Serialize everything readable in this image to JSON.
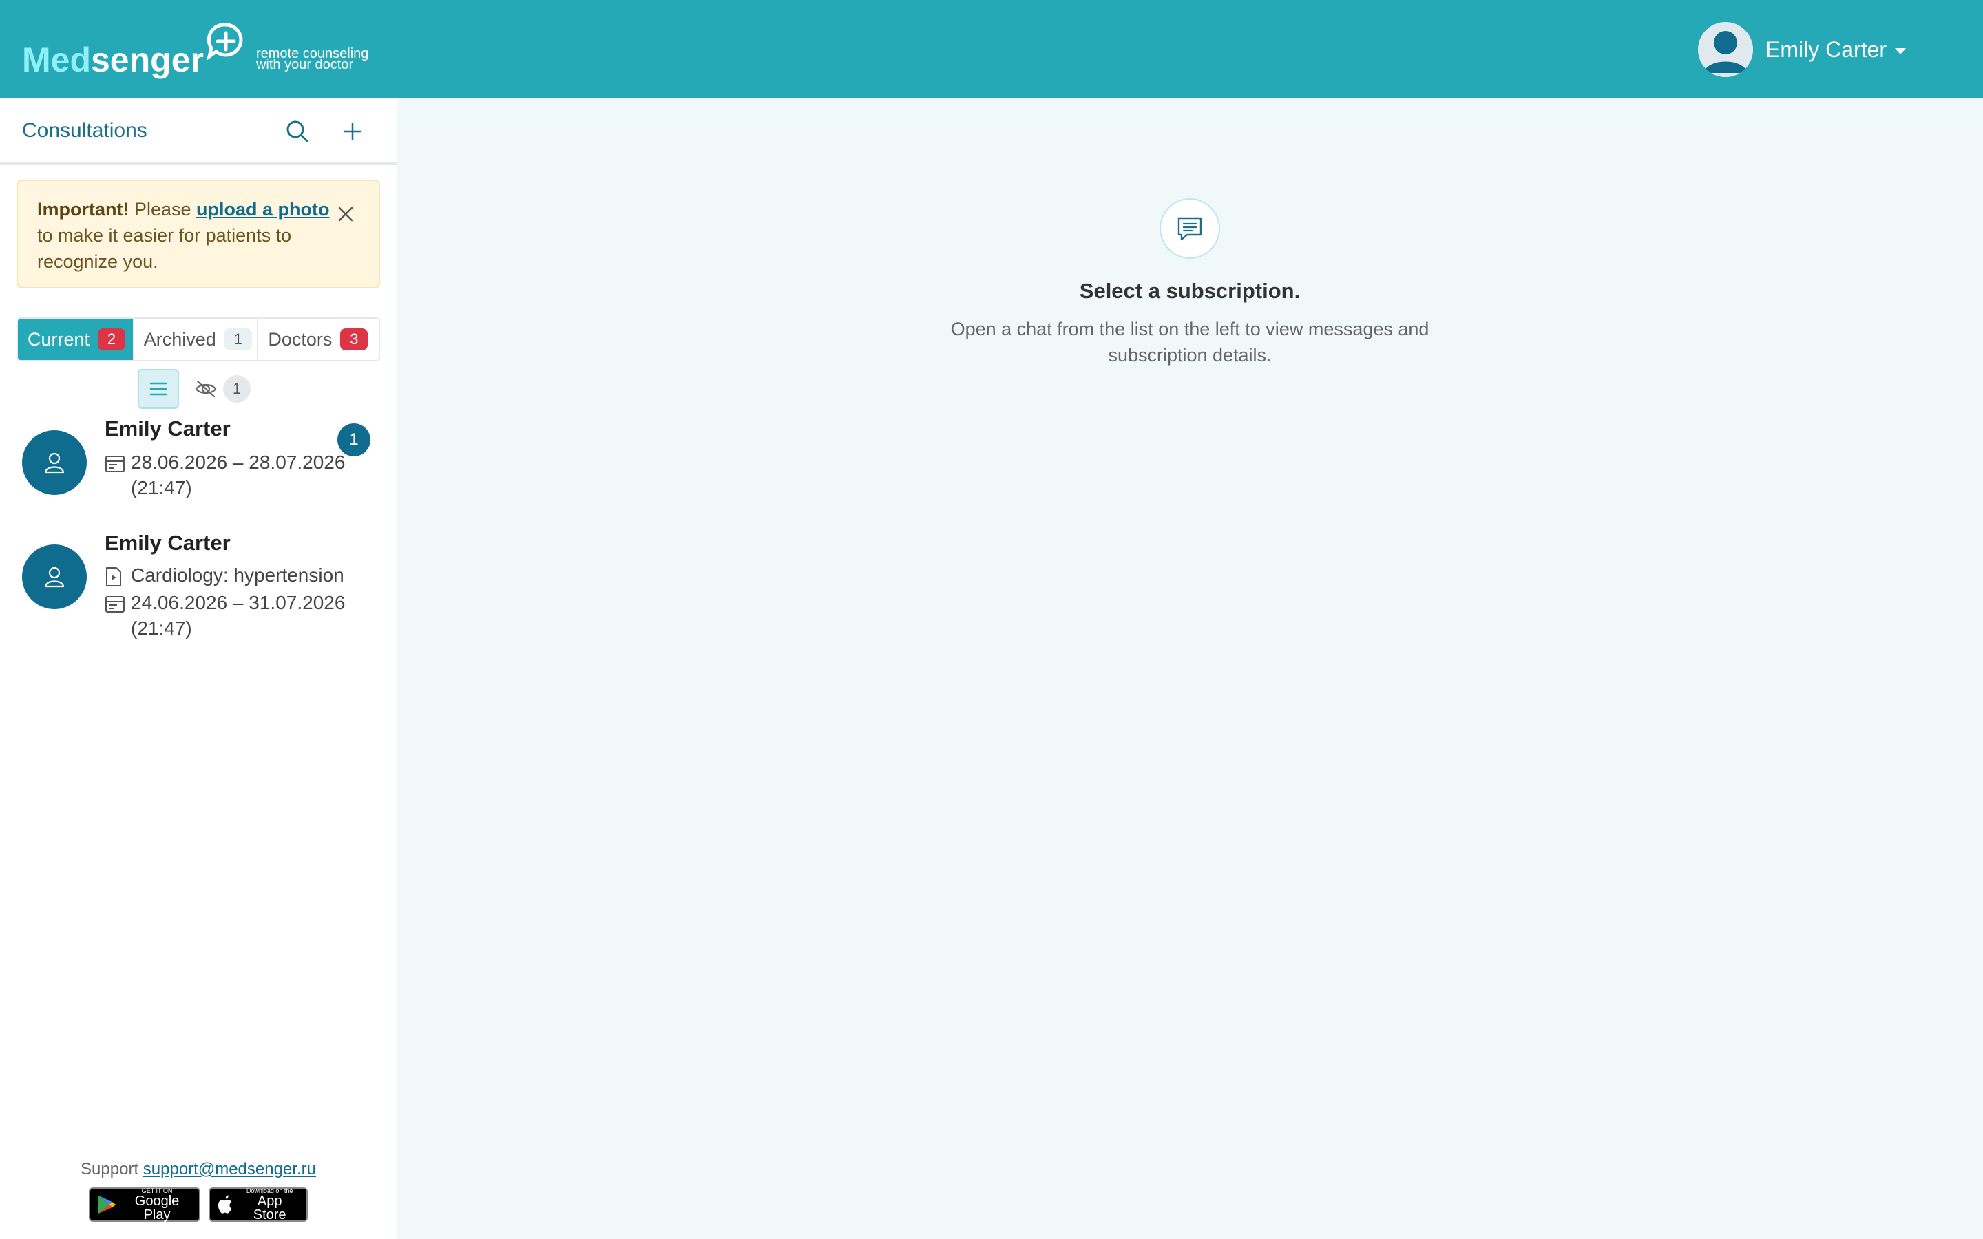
{
  "header": {
    "logo": {
      "med": "Med",
      "senger": "senger",
      "tagline_1": "remote counseling",
      "tagline_2": "with your doctor"
    },
    "user_name": "Emily Carter"
  },
  "sidebar": {
    "title": "Consultations",
    "notice": {
      "bold": "Important!",
      "pre_link": " Please ",
      "link": "upload a photo",
      "post_link": " to make it easier for patients to recognize you."
    },
    "tabs": [
      {
        "label": "Current",
        "count": "2"
      },
      {
        "label": "Archived",
        "count": "1"
      },
      {
        "label": "Doctors",
        "count": "3"
      }
    ],
    "hidden_count": "1",
    "chats": [
      {
        "name": "Emily Carter",
        "date_range": "28.06.2026 – 28.07.2026",
        "time": "(21:47)",
        "unread": "1"
      },
      {
        "name": "Emily Carter",
        "program": "Cardiology: hypertension",
        "date_range": "24.06.2026 – 31.07.2026",
        "time": "(21:47)"
      }
    ],
    "footer": {
      "support_label": "Support",
      "support_email": "support@medsenger.ru",
      "google_small": "GET IT ON",
      "google_big": "Google Play",
      "apple_small": "Download on the",
      "apple_big": "App Store"
    }
  },
  "main": {
    "empty_title": "Select a subscription.",
    "empty_text": "Open a chat from the list on the left to view messages and subscription details."
  },
  "colors": {
    "header": "#25a9b6",
    "accent": "#0f6c8f",
    "badge_red": "#dc3545",
    "notice_bg": "#fff6df"
  },
  "icons": [
    "logo-plus-bubble-icon",
    "user-avatar-icon",
    "chevron-down-icon",
    "search-icon",
    "plus-icon",
    "close-icon",
    "list-icon",
    "eye-off-icon",
    "person-icon",
    "calendar-icon",
    "document-play-icon",
    "chat-icon",
    "google-play-icon",
    "apple-icon"
  ]
}
